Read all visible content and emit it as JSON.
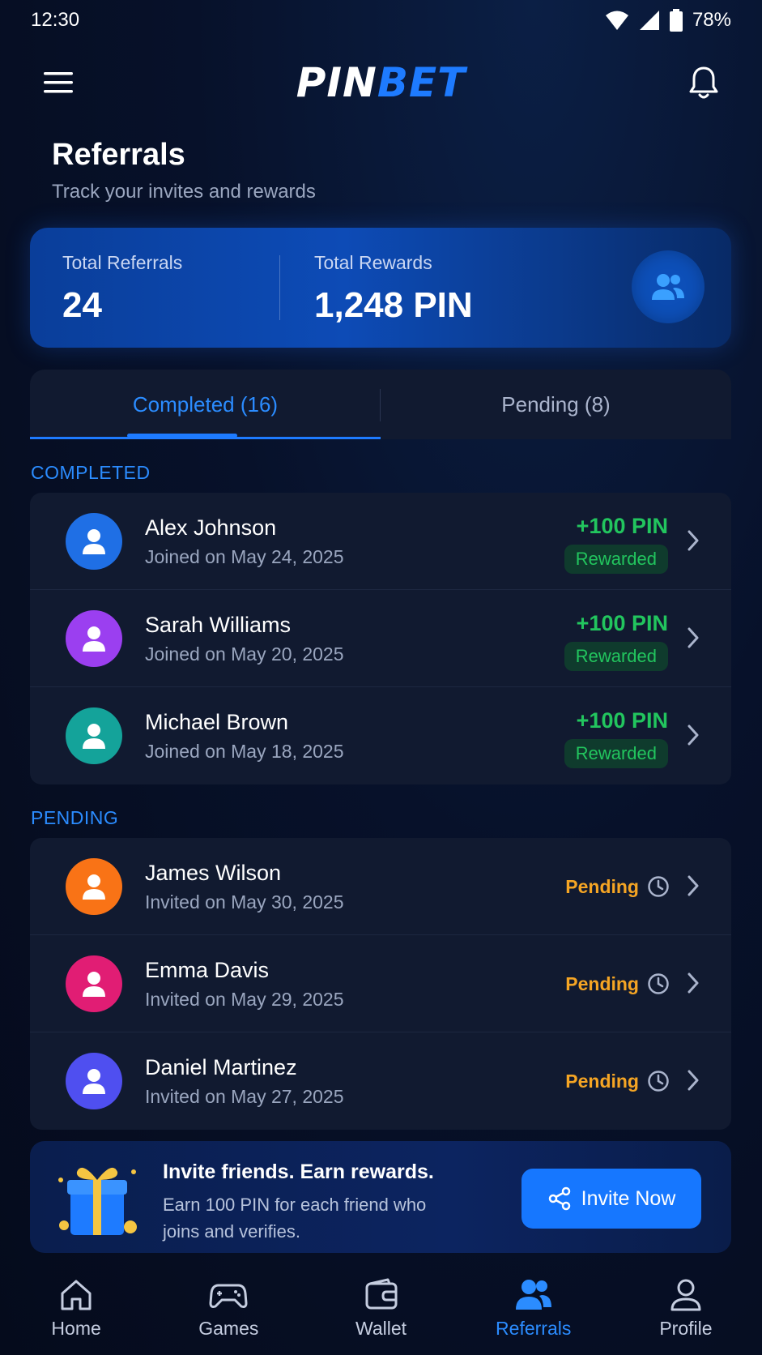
{
  "status_bar": {
    "time": "12:30",
    "battery": "78%"
  },
  "header": {
    "logo_part1": "PIN",
    "logo_part2": "BET"
  },
  "page": {
    "title": "Referrals",
    "subtitle": "Track your invites and rewards"
  },
  "summary": {
    "referrals_label": "Total Referrals",
    "referrals_value": "24",
    "rewards_label": "Total Rewards",
    "rewards_value": "1,248 PIN"
  },
  "tabs": [
    {
      "label": "Completed (16)",
      "active": true
    },
    {
      "label": "Pending (8)",
      "active": false
    }
  ],
  "completed": {
    "section_label": "COMPLETED",
    "items": [
      {
        "name": "Alex Johnson",
        "date": "Joined on May 24, 2025",
        "amount": "+100 PIN",
        "status": "Rewarded",
        "avatar_color": "#1f6fe5"
      },
      {
        "name": "Sarah Williams",
        "date": "Joined on May 20, 2025",
        "amount": "+100 PIN",
        "status": "Rewarded",
        "avatar_color": "#9b3ff0"
      },
      {
        "name": "Michael Brown",
        "date": "Joined on May 18, 2025",
        "amount": "+100 PIN",
        "status": "Rewarded",
        "avatar_color": "#14a39a"
      }
    ]
  },
  "pending": {
    "section_label": "PENDING",
    "items": [
      {
        "name": "James Wilson",
        "date": "Invited on May 30, 2025",
        "status": "Pending",
        "avatar_color": "#f97316"
      },
      {
        "name": "Emma Davis",
        "date": "Invited on May 29, 2025",
        "status": "Pending",
        "avatar_color": "#e11d74"
      },
      {
        "name": "Daniel Martinez",
        "date": "Invited on May 27, 2025",
        "status": "Pending",
        "avatar_color": "#4f4ff0"
      }
    ]
  },
  "promo": {
    "title": "Invite friends. Earn rewards.",
    "description": "Earn 100 PIN for each friend who joins and verifies.",
    "button_label": "Invite Now"
  },
  "nav": [
    {
      "label": "Home",
      "icon": "home-icon",
      "active": false
    },
    {
      "label": "Games",
      "icon": "gamepad-icon",
      "active": false
    },
    {
      "label": "Wallet",
      "icon": "wallet-icon",
      "active": false
    },
    {
      "label": "Referrals",
      "icon": "users-icon",
      "active": true
    },
    {
      "label": "Profile",
      "icon": "profile-icon",
      "active": false
    }
  ],
  "colors": {
    "accent": "#1e7bff",
    "success": "#22c55e",
    "warning": "#f5a524",
    "background": "#07112a"
  }
}
